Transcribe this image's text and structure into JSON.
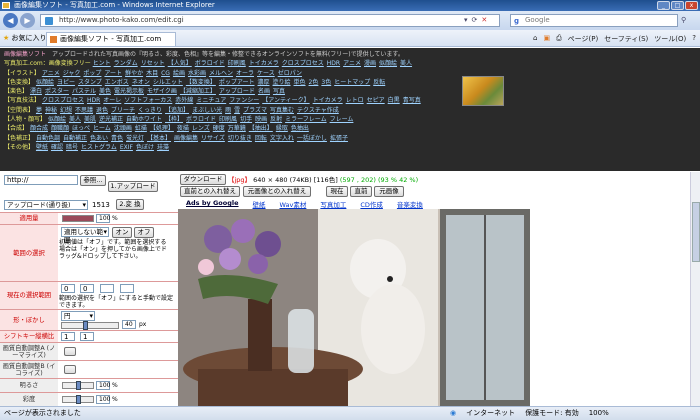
{
  "window": {
    "title": "画像編集ソフト - 写真加工.com - Windows Internet Explorer"
  },
  "address": {
    "url": "http://www.photo-kako.com/edit.cgi",
    "search_placeholder": "Google"
  },
  "favorites": {
    "label": "お気に入り",
    "tab_title": "画像編集ソフト - 写真加工.com"
  },
  "commands": [
    "ページ(P)",
    "セーフティ(S)",
    "ツール(O)",
    "?"
  ],
  "nav": {
    "brand": "画像編集ソフト",
    "intro": "アップロードされた写真画像の『明るさ、彩度、色相』等を編集・修整できるオンラインソフトを無料(フリー)で提供しています。",
    "rows": [
      {
        "label": "写真加工.com：画像変換フリー",
        "links": [
          "ヒント",
          "ランダム",
          "リセット",
          "【人気】",
          "ボラロイド",
          "印刷風",
          "トイカメラ",
          "クロスプロセス",
          "HDR",
          "アニメ",
          "漫画",
          "似顔絵",
          "美人"
        ]
      },
      {
        "label": "【イラスト】",
        "links": [
          "アニメ",
          "ジャク",
          "ポップ",
          "アート",
          "鮮やか",
          "木目",
          "CG",
          "絵画",
          "水彩画",
          "メルヘン",
          "オーラ",
          "ケース",
          "ゼロパン"
        ]
      },
      {
        "label": "【色変換】",
        "links": [
          "似顔絵",
          "ヨピー",
          "スタンプ",
          "エンボス",
          "ネオン",
          "シルエット",
          "【数変換】",
          "ポップアート",
          "濃厚",
          "塗り絵",
          "単色",
          "2色",
          "3色",
          "ヒートマップ",
          "反転"
        ]
      },
      {
        "label": "【楽色】",
        "links": [
          "漂白",
          "ポスター",
          "パステル",
          "美色",
          "電光掲示板",
          "モザイク画",
          "【減縮加工】",
          "アップロード",
          "名画",
          "写真"
        ]
      },
      {
        "label": "【写真技法】",
        "links": [
          "クロスプロセス",
          "HDR",
          "オーレ",
          "ソフトフォーカス",
          "赤外線",
          "ミニチュア",
          "ファンシー",
          "【アンティーク】",
          "トイカメラ",
          "レトロ",
          "セピア",
          "白黒",
          "青写真"
        ]
      },
      {
        "label": "【空間表】",
        "links": [
          "夢",
          "神秘",
          "幻想",
          "不思議",
          "退色",
          "ブリーチ",
          "くっきり",
          "【追加】",
          "まぶしい光",
          "雨",
          "雪",
          "プラズマ",
          "写真集む",
          "テクスチャ作成"
        ]
      },
      {
        "label": "【人物・顔写】",
        "links": [
          "似顔絵",
          "美人",
          "美肌",
          "逆光補正",
          "自動ホワイト",
          "【枠】",
          "ボラロイド",
          "印刷風",
          "切手",
          "映画",
          "反射",
          "ミラーフレーム",
          "フレーム"
        ]
      },
      {
        "label": "【合成】",
        "links": [
          "顔合成",
          "顔職顔",
          "ほっぺ",
          "ヒーム",
          "沈頭画",
          "虹描",
          "【処理】",
          "夜描",
          "レンズ",
          "硬度",
          "万華鏡",
          "【抽出】",
          "縁取",
          "色抽出"
        ]
      },
      {
        "label": "【色補正】",
        "links": [
          "自動色調",
          "自動補正",
          "色あい",
          "青色",
          "蛍光灯",
          "【基本】",
          "画像編集",
          "リサイズ",
          "切り抜き",
          "回転",
          "文字入れ",
          "一括ぼかし",
          "拡張子"
        ]
      },
      {
        "label": "【その他】",
        "links": [
          "壁紙",
          "確認",
          "暗号",
          "ヒストグラム",
          "EXIF",
          "色ぼけ",
          "珪藻"
        ]
      }
    ]
  },
  "upload": {
    "path_value": "http://",
    "browse_label": "参照...",
    "upload_label": "1.アップロード",
    "mode_value": "アップロード(通り扱)",
    "count": "1513",
    "convert_label": "2.変 換"
  },
  "controls": {
    "download": "ダウンロード",
    "swap_prev": "直前との入れ替え",
    "swap_orig": "元画像との入れ替え",
    "current": "現在",
    "previous": "直前",
    "original": "元画像",
    "info_type": "【jpg】",
    "info_size": "640 × 480 (74KB)",
    "info_colors": "[116色]",
    "info_coord": "(597 , 202)",
    "info_pct": "(93 % 42 %)"
  },
  "ads": {
    "title": "Ads by Google",
    "links": [
      "壁紙",
      "Wav素材",
      "写真加工",
      "CD作成",
      "音楽変換"
    ]
  },
  "panel": [
    {
      "label": "適用量",
      "value": "100",
      "unit": "%",
      "level": 1.0
    },
    {
      "label": "範囲の選択",
      "select": "適用しない範囲",
      "on": "オン",
      "off": "オフ",
      "desc": "初期値は「オフ」です。範囲を選択する場合は「オン」を押してから画像上でドラッグ&ドロップして下さい。"
    },
    {
      "label": "現在の選択範囲",
      "x1": "0",
      "y1": "0",
      "desc": "範囲の選択を「オフ」にすると手動で設定できます。"
    },
    {
      "label": "形・ぼかし",
      "shape": "円",
      "blur": "40",
      "unit": "px",
      "level": 0.4
    },
    {
      "label": "シフトキー縦横比",
      "a": "1",
      "b": "1"
    },
    {
      "label": "画質自動調整A (ノーマライズ)"
    },
    {
      "label": "画質自動調整B (イコライズ)"
    },
    {
      "label": "明るさ",
      "value": "100",
      "unit": "%",
      "level": 0.5
    },
    {
      "label": "彩度",
      "value": "100",
      "unit": "%",
      "level": 0.5
    }
  ],
  "status": {
    "left": "ページが表示されました",
    "internet": "インターネット",
    "protect": "保護モード: 有効",
    "zoom": "100%"
  }
}
